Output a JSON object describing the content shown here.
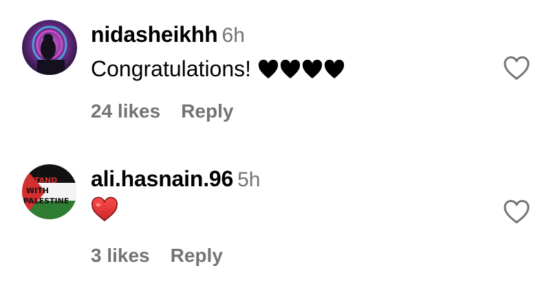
{
  "comments": [
    {
      "username": "nidasheikhh",
      "time": "6h",
      "text": "Congratulations!",
      "emoji": "black-hearts",
      "emoji_count": 4,
      "likes": "24 likes",
      "reply": "Reply",
      "avatar": "avatar-nidasheikhh"
    },
    {
      "username": "ali.hasnain.96",
      "time": "5h",
      "text": "",
      "emoji": "red-heart",
      "likes": "3 likes",
      "reply": "Reply",
      "avatar": "avatar-ali-hasnain",
      "avatar_text": [
        "I STAND",
        "WITH",
        "PALESTINE"
      ]
    }
  ],
  "colors": {
    "secondary_text": "#737373",
    "heart_outline": "#737373",
    "red_heart": "#e53935",
    "black_heart": "#000000"
  },
  "icons": {
    "like_button": "heart-outline-icon"
  }
}
